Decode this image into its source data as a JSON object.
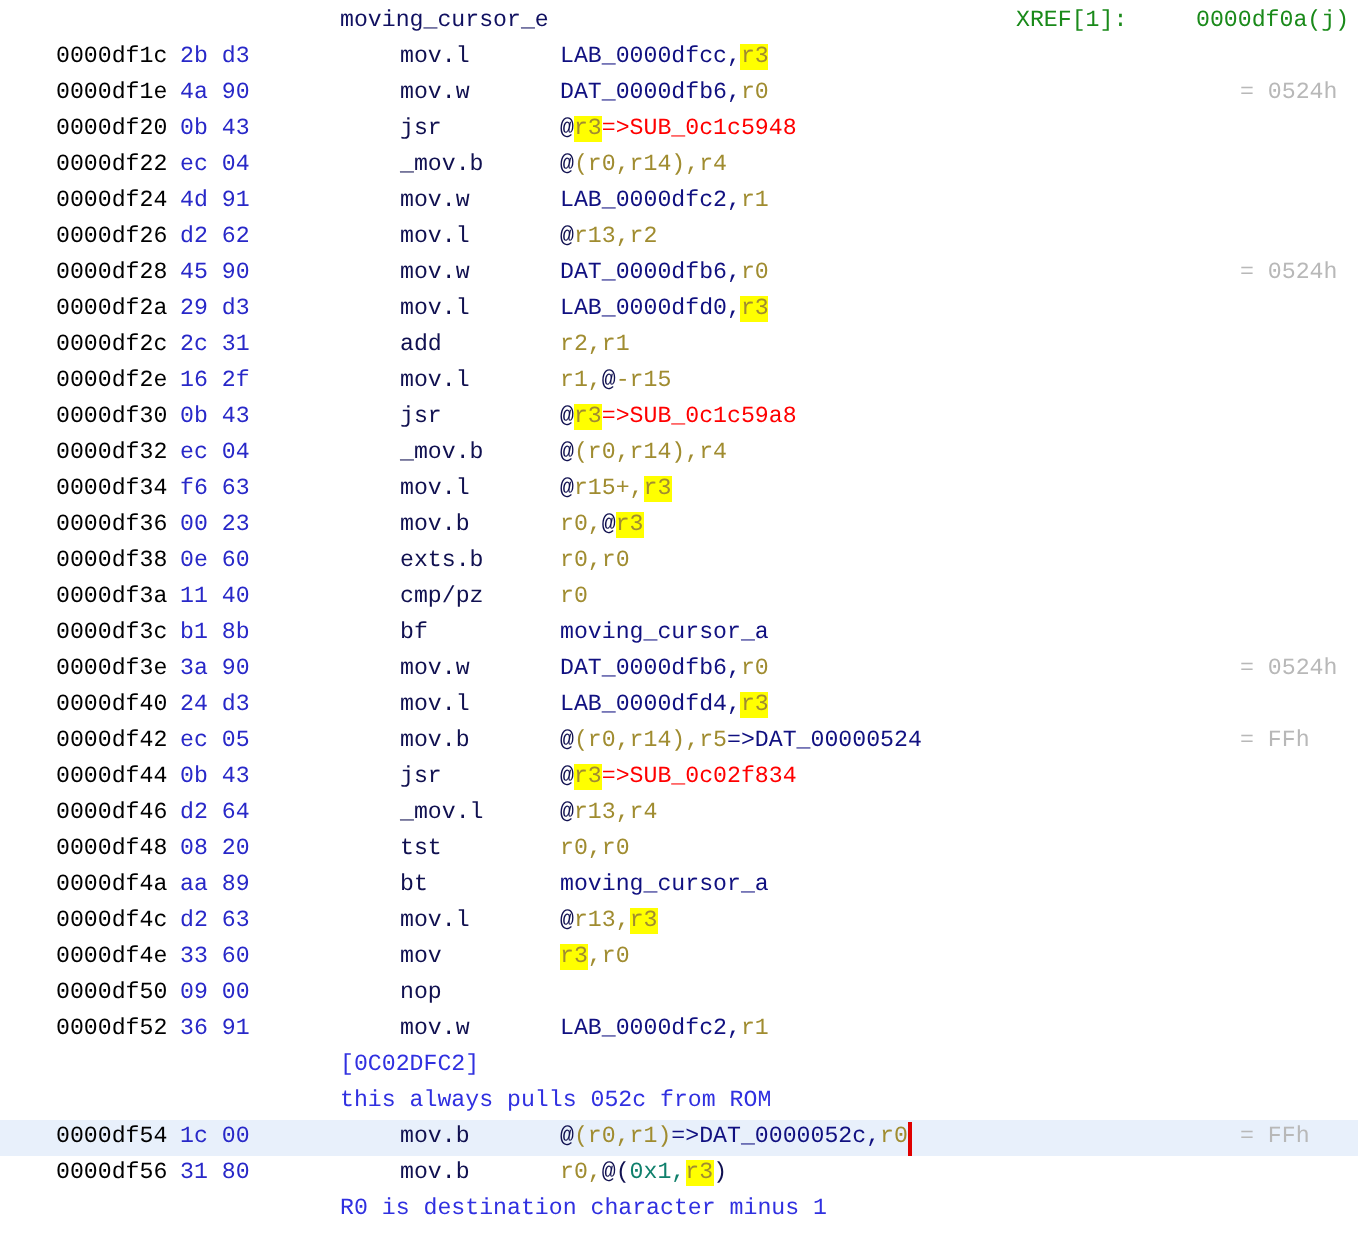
{
  "listing": [
    {
      "kind": "label",
      "text": "moving_cursor_e",
      "xref_label": "XREF[1]:",
      "xref": "0000df0a(j)"
    },
    {
      "kind": "instruction",
      "address": "0000df1c",
      "bytes": "2b d3",
      "mnemonic": "mov.l",
      "operands": [
        {
          "kind": "label",
          "text": "LAB_0000dfcc,"
        },
        {
          "kind": "reg",
          "text": "r3",
          "highlighted": true
        }
      ],
      "selected": false
    },
    {
      "kind": "instruction",
      "address": "0000df1e",
      "bytes": "4a 90",
      "mnemonic": "mov.w",
      "operands": [
        {
          "kind": "label",
          "text": "DAT_0000dfb6,"
        },
        {
          "kind": "reg",
          "text": "r0",
          "highlighted": false
        }
      ],
      "comment": "= 0524h",
      "selected": false
    },
    {
      "kind": "instruction",
      "address": "0000df20",
      "bytes": "0b 43",
      "mnemonic": "jsr",
      "operands": [
        {
          "kind": "text",
          "text": "@"
        },
        {
          "kind": "reg",
          "text": "r3",
          "highlighted": true
        },
        {
          "kind": "ref",
          "text": "=>SUB_0c1c5948"
        }
      ],
      "selected": false
    },
    {
      "kind": "instruction",
      "address": "0000df22",
      "bytes": "ec 04",
      "mnemonic": "_mov.b",
      "operands": [
        {
          "kind": "text",
          "text": "@"
        },
        {
          "kind": "reg",
          "text": "(r0,r14),r4",
          "highlighted": false
        }
      ],
      "selected": false
    },
    {
      "kind": "instruction",
      "address": "0000df24",
      "bytes": "4d 91",
      "mnemonic": "mov.w",
      "operands": [
        {
          "kind": "label",
          "text": "LAB_0000dfc2,"
        },
        {
          "kind": "reg",
          "text": "r1",
          "highlighted": false
        }
      ],
      "selected": false
    },
    {
      "kind": "instruction",
      "address": "0000df26",
      "bytes": "d2 62",
      "mnemonic": "mov.l",
      "operands": [
        {
          "kind": "text",
          "text": "@"
        },
        {
          "kind": "reg",
          "text": "r13,r2",
          "highlighted": false
        }
      ],
      "selected": false
    },
    {
      "kind": "instruction",
      "address": "0000df28",
      "bytes": "45 90",
      "mnemonic": "mov.w",
      "operands": [
        {
          "kind": "label",
          "text": "DAT_0000dfb6,"
        },
        {
          "kind": "reg",
          "text": "r0",
          "highlighted": false
        }
      ],
      "comment": "= 0524h",
      "selected": false
    },
    {
      "kind": "instruction",
      "address": "0000df2a",
      "bytes": "29 d3",
      "mnemonic": "mov.l",
      "operands": [
        {
          "kind": "label",
          "text": "LAB_0000dfd0,"
        },
        {
          "kind": "reg",
          "text": "r3",
          "highlighted": true
        }
      ],
      "selected": false
    },
    {
      "kind": "instruction",
      "address": "0000df2c",
      "bytes": "2c 31",
      "mnemonic": "add",
      "operands": [
        {
          "kind": "reg",
          "text": "r2,r1",
          "highlighted": false
        }
      ],
      "selected": false
    },
    {
      "kind": "instruction",
      "address": "0000df2e",
      "bytes": "16 2f",
      "mnemonic": "mov.l",
      "operands": [
        {
          "kind": "reg",
          "text": "r1,",
          "highlighted": false
        },
        {
          "kind": "text",
          "text": "@"
        },
        {
          "kind": "reg",
          "text": "-r15",
          "highlighted": false
        }
      ],
      "selected": false
    },
    {
      "kind": "instruction",
      "address": "0000df30",
      "bytes": "0b 43",
      "mnemonic": "jsr",
      "operands": [
        {
          "kind": "text",
          "text": "@"
        },
        {
          "kind": "reg",
          "text": "r3",
          "highlighted": true
        },
        {
          "kind": "ref",
          "text": "=>SUB_0c1c59a8"
        }
      ],
      "selected": false
    },
    {
      "kind": "instruction",
      "address": "0000df32",
      "bytes": "ec 04",
      "mnemonic": "_mov.b",
      "operands": [
        {
          "kind": "text",
          "text": "@"
        },
        {
          "kind": "reg",
          "text": "(r0,r14),r4",
          "highlighted": false
        }
      ],
      "selected": false
    },
    {
      "kind": "instruction",
      "address": "0000df34",
      "bytes": "f6 63",
      "mnemonic": "mov.l",
      "operands": [
        {
          "kind": "text",
          "text": "@"
        },
        {
          "kind": "reg",
          "text": "r15+,",
          "highlighted": false
        },
        {
          "kind": "reg",
          "text": "r3",
          "highlighted": true
        }
      ],
      "selected": false
    },
    {
      "kind": "instruction",
      "address": "0000df36",
      "bytes": "00 23",
      "mnemonic": "mov.b",
      "operands": [
        {
          "kind": "reg",
          "text": "r0,",
          "highlighted": false
        },
        {
          "kind": "text",
          "text": "@"
        },
        {
          "kind": "reg",
          "text": "r3",
          "highlighted": true
        }
      ],
      "selected": false
    },
    {
      "kind": "instruction",
      "address": "0000df38",
      "bytes": "0e 60",
      "mnemonic": "exts.b",
      "operands": [
        {
          "kind": "reg",
          "text": "r0,r0",
          "highlighted": false
        }
      ],
      "selected": false
    },
    {
      "kind": "instruction",
      "address": "0000df3a",
      "bytes": "11 40",
      "mnemonic": "cmp/pz",
      "operands": [
        {
          "kind": "reg",
          "text": "r0",
          "highlighted": false
        }
      ],
      "selected": false
    },
    {
      "kind": "instruction",
      "address": "0000df3c",
      "bytes": "b1 8b",
      "mnemonic": "bf",
      "operands": [
        {
          "kind": "label",
          "text": "moving_cursor_a"
        }
      ],
      "selected": false
    },
    {
      "kind": "instruction",
      "address": "0000df3e",
      "bytes": "3a 90",
      "mnemonic": "mov.w",
      "operands": [
        {
          "kind": "label",
          "text": "DAT_0000dfb6,"
        },
        {
          "kind": "reg",
          "text": "r0",
          "highlighted": false
        }
      ],
      "comment": "= 0524h",
      "selected": false
    },
    {
      "kind": "instruction",
      "address": "0000df40",
      "bytes": "24 d3",
      "mnemonic": "mov.l",
      "operands": [
        {
          "kind": "label",
          "text": "LAB_0000dfd4,"
        },
        {
          "kind": "reg",
          "text": "r3",
          "highlighted": true
        }
      ],
      "selected": false
    },
    {
      "kind": "instruction",
      "address": "0000df42",
      "bytes": "ec 05",
      "mnemonic": "mov.b",
      "operands": [
        {
          "kind": "text",
          "text": "@"
        },
        {
          "kind": "reg",
          "text": "(r0,r14),r5",
          "highlighted": false
        },
        {
          "kind": "label",
          "text": "=>DAT_00000524"
        }
      ],
      "comment": "= FFh",
      "selected": false
    },
    {
      "kind": "instruction",
      "address": "0000df44",
      "bytes": "0b 43",
      "mnemonic": "jsr",
      "operands": [
        {
          "kind": "text",
          "text": "@"
        },
        {
          "kind": "reg",
          "text": "r3",
          "highlighted": true
        },
        {
          "kind": "ref",
          "text": "=>SUB_0c02f834"
        }
      ],
      "selected": false
    },
    {
      "kind": "instruction",
      "address": "0000df46",
      "bytes": "d2 64",
      "mnemonic": "_mov.l",
      "operands": [
        {
          "kind": "text",
          "text": "@"
        },
        {
          "kind": "reg",
          "text": "r13,r4",
          "highlighted": false
        }
      ],
      "selected": false
    },
    {
      "kind": "instruction",
      "address": "0000df48",
      "bytes": "08 20",
      "mnemonic": "tst",
      "operands": [
        {
          "kind": "reg",
          "text": "r0,r0",
          "highlighted": false
        }
      ],
      "selected": false
    },
    {
      "kind": "instruction",
      "address": "0000df4a",
      "bytes": "aa 89",
      "mnemonic": "bt",
      "operands": [
        {
          "kind": "label",
          "text": "moving_cursor_a"
        }
      ],
      "selected": false
    },
    {
      "kind": "instruction",
      "address": "0000df4c",
      "bytes": "d2 63",
      "mnemonic": "mov.l",
      "operands": [
        {
          "kind": "text",
          "text": "@"
        },
        {
          "kind": "reg",
          "text": "r13,",
          "highlighted": false
        },
        {
          "kind": "reg",
          "text": "r3",
          "highlighted": true
        }
      ],
      "selected": false
    },
    {
      "kind": "instruction",
      "address": "0000df4e",
      "bytes": "33 60",
      "mnemonic": "mov",
      "operands": [
        {
          "kind": "reg",
          "text": "r3",
          "highlighted": true
        },
        {
          "kind": "reg",
          "text": ",r0",
          "highlighted": false
        }
      ],
      "selected": false
    },
    {
      "kind": "instruction",
      "address": "0000df50",
      "bytes": "09 00",
      "mnemonic": "nop",
      "selected": false
    },
    {
      "kind": "instruction",
      "address": "0000df52",
      "bytes": "36 91",
      "mnemonic": "mov.w",
      "operands": [
        {
          "kind": "label",
          "text": "LAB_0000dfc2,"
        },
        {
          "kind": "reg",
          "text": "r1",
          "highlighted": false
        }
      ],
      "selected": false
    },
    {
      "kind": "comment",
      "text": "[0C02DFC2]"
    },
    {
      "kind": "comment",
      "text": "this always pulls 052c from ROM"
    },
    {
      "kind": "instruction",
      "address": "0000df54",
      "bytes": "1c 00",
      "mnemonic": "mov.b",
      "operands": [
        {
          "kind": "text",
          "text": "@"
        },
        {
          "kind": "reg",
          "text": "(r0,r1)",
          "highlighted": false
        },
        {
          "kind": "label",
          "text": "=>DAT_0000052c,"
        },
        {
          "kind": "reg",
          "text": "r0",
          "highlighted": false
        }
      ],
      "comment": "= FFh",
      "selected": true
    },
    {
      "kind": "instruction",
      "address": "0000df56",
      "bytes": "31 80",
      "mnemonic": "mov.b",
      "operands": [
        {
          "kind": "reg",
          "text": "r0,",
          "highlighted": false
        },
        {
          "kind": "text",
          "text": "@("
        },
        {
          "kind": "num",
          "text": "0x1,"
        },
        {
          "kind": "reg",
          "text": "r3",
          "highlighted": true
        },
        {
          "kind": "text",
          "text": ")"
        }
      ],
      "selected": false
    },
    {
      "kind": "comment",
      "text": "R0 is destination character minus 1"
    }
  ]
}
